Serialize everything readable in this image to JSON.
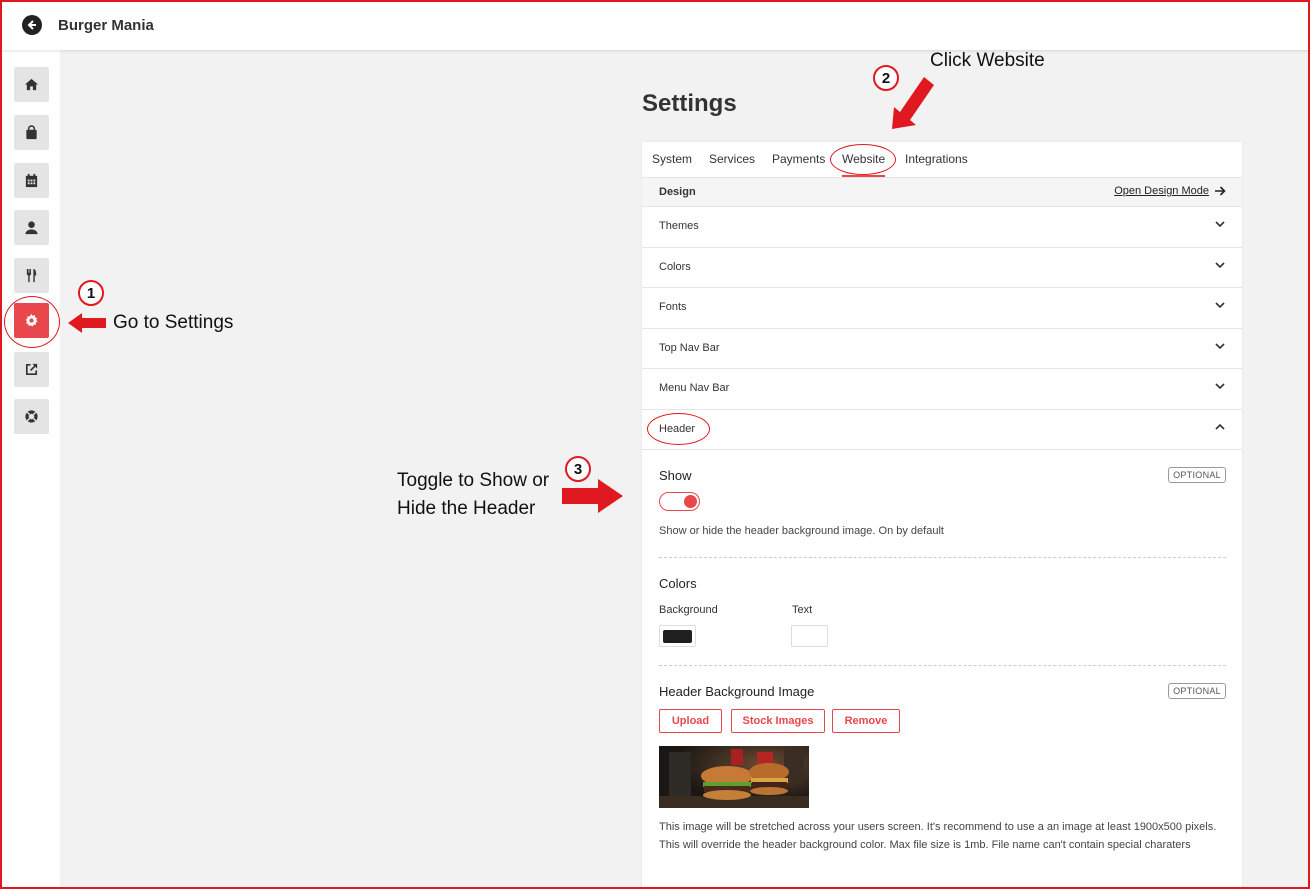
{
  "app": {
    "title": "Burger Mania"
  },
  "sidebar": {
    "items": [
      {
        "icon": "home-icon"
      },
      {
        "icon": "shopping-bag-icon"
      },
      {
        "icon": "calendar-icon"
      },
      {
        "icon": "user-icon"
      },
      {
        "icon": "utensils-icon"
      },
      {
        "icon": "gear-icon",
        "active": true
      },
      {
        "icon": "external-link-icon"
      },
      {
        "icon": "lifebuoy-icon"
      }
    ]
  },
  "page": {
    "title": "Settings"
  },
  "tabs": [
    "System",
    "Services",
    "Payments",
    "Website",
    "Integrations"
  ],
  "active_tab": "Website",
  "design_bar": {
    "label": "Design",
    "link": "Open Design Mode"
  },
  "accordion": [
    "Themes",
    "Colors",
    "Fonts",
    "Top Nav Bar",
    "Menu Nav Bar",
    "Header"
  ],
  "header_section": {
    "show": {
      "title": "Show",
      "badge": "OPTIONAL",
      "enabled": true,
      "help": "Show or hide the header background image. On by default"
    },
    "colors": {
      "title": "Colors",
      "background_label": "Background",
      "text_label": "Text",
      "background_color": "#1f1f1f",
      "text_color": "#ffffff"
    },
    "image": {
      "title": "Header Background Image",
      "badge": "OPTIONAL",
      "buttons": [
        "Upload",
        "Stock Images",
        "Remove"
      ],
      "help": "This image will be stretched across your users screen. It's recommend to use a an image at least 1900x500 pixels. This will override the header background color. Max file size is 1mb. File name can't contain special charaters"
    }
  },
  "annotations": {
    "step1": {
      "number": "1",
      "text": "Go to Settings"
    },
    "step2": {
      "number": "2",
      "text": "Click Website"
    },
    "step3": {
      "number": "3",
      "text_line1": "Toggle to Show or",
      "text_line2": "Hide the Header"
    }
  },
  "colors": {
    "accent": "#e8474b",
    "annotation_red": "#e0181f"
  }
}
